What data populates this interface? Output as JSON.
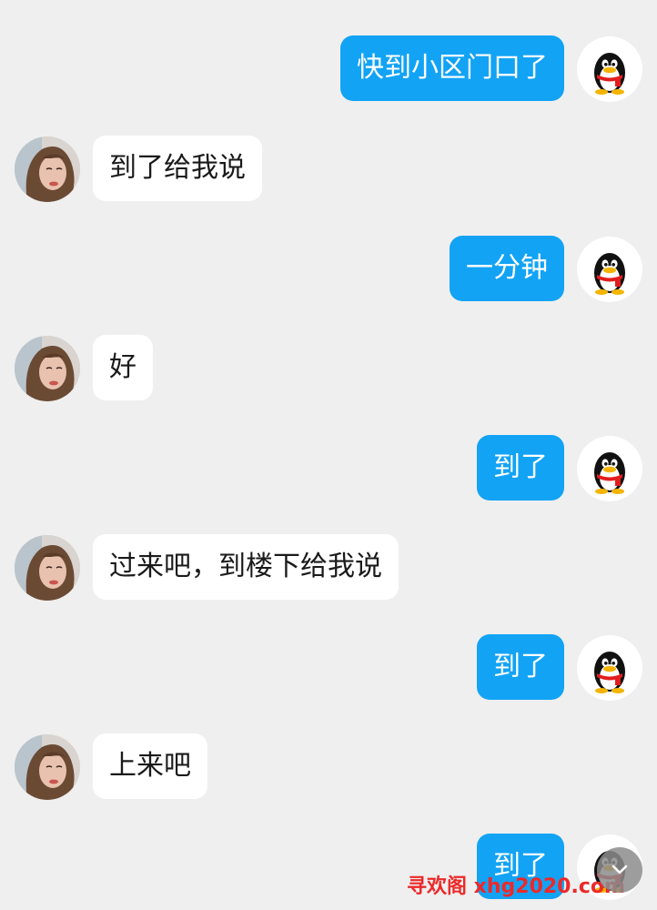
{
  "colors": {
    "background": "#efefef",
    "outgoing_bubble": "#12a3f5",
    "incoming_bubble": "#ffffff",
    "watermark": "#ec2929"
  },
  "messages": [
    {
      "direction": "out",
      "text": "快到小区门口了",
      "avatar": "qq-penguin-icon"
    },
    {
      "direction": "in",
      "text": "到了给我说",
      "avatar": "contact-photo"
    },
    {
      "direction": "out",
      "text": "一分钟",
      "avatar": "qq-penguin-icon"
    },
    {
      "direction": "in",
      "text": "好",
      "avatar": "contact-photo"
    },
    {
      "direction": "out",
      "text": "到了",
      "avatar": "qq-penguin-icon"
    },
    {
      "direction": "in",
      "text": "过来吧，到楼下给我说",
      "avatar": "contact-photo"
    },
    {
      "direction": "out",
      "text": "到了",
      "avatar": "qq-penguin-icon"
    },
    {
      "direction": "in",
      "text": "上来吧",
      "avatar": "contact-photo"
    },
    {
      "direction": "out",
      "text": "到了",
      "avatar": "qq-penguin-icon"
    }
  ],
  "watermark": {
    "text": "寻欢阁 xhg2020.com"
  },
  "scroll_button": {
    "icon": "chevron-down-icon"
  }
}
